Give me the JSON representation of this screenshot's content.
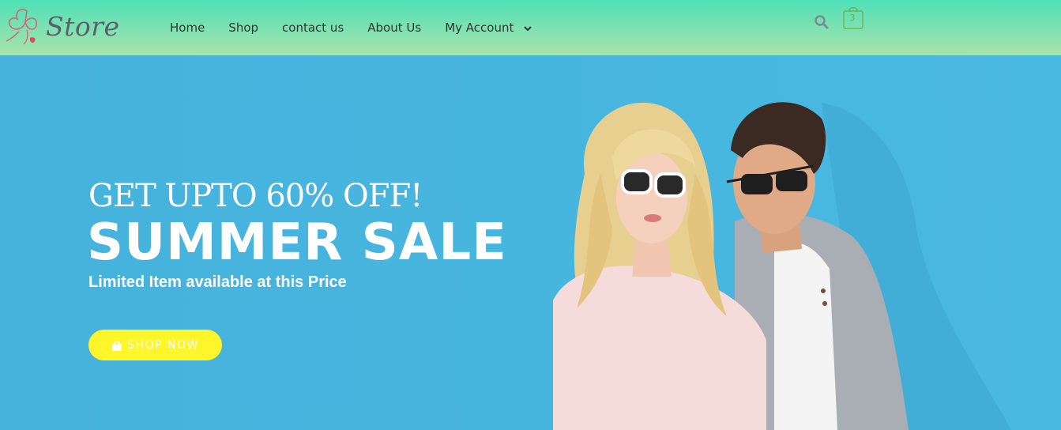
{
  "brand": {
    "name": "Store",
    "logo_icon": "flower-logo-icon"
  },
  "nav": {
    "items": [
      {
        "label": "Home"
      },
      {
        "label": "Shop"
      },
      {
        "label": "contact us"
      },
      {
        "label": "About Us"
      },
      {
        "label": "My Account"
      }
    ]
  },
  "header_actions": {
    "search_icon": "search-icon",
    "cart_icon": "shopping-bag-icon",
    "cart_count": "3"
  },
  "hero": {
    "line1": "GET UPTO 60% OFF!",
    "line2": "SUMMER SALE",
    "line3": "Limited Item available at this Price",
    "button_label": "SHOP NOW",
    "button_icon": "shopping-bag-icon",
    "image": "couple-in-sunglasses-photo"
  },
  "colors": {
    "header_top": "#4fe0b6",
    "header_bottom": "#a9e3ac",
    "hero_bg": "#47b6df",
    "button_bg": "#fef62a",
    "nav_text": "#333333"
  }
}
